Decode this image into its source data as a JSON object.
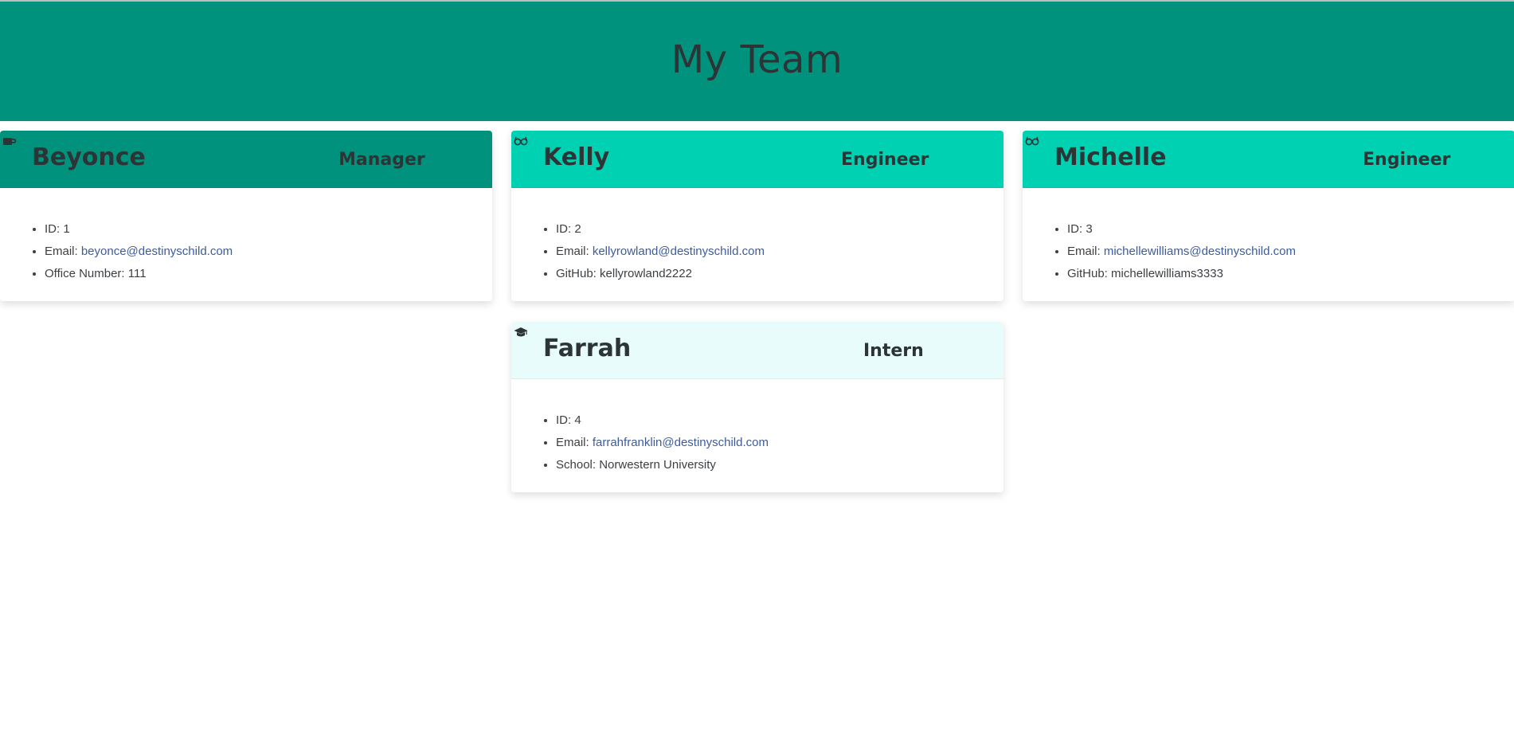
{
  "page": {
    "title": "My Team"
  },
  "colors": {
    "banner": "#00927d",
    "manager_header": "#00927d",
    "engineer_header": "#00d1b3",
    "intern_header": "#e8fdfb",
    "link": "#3d5c99",
    "text": "#2d3436"
  },
  "cards": [
    {
      "name": "Beyonce",
      "role": "Manager",
      "icon": "coffee-mug-icon",
      "id_label": "ID: 1",
      "email_label": "Email: ",
      "email": "beyonce@destinyschild.com",
      "extra_label": "Office Number: 111"
    },
    {
      "name": "Kelly",
      "role": "Engineer",
      "icon": "glasses-icon",
      "id_label": "ID: 2",
      "email_label": "Email: ",
      "email": "kellyrowland@destinyschild.com",
      "extra_label": "GitHub: kellyrowland2222"
    },
    {
      "name": "Michelle",
      "role": "Engineer",
      "icon": "glasses-icon",
      "id_label": "ID: 3",
      "email_label": "Email: ",
      "email": "michellewilliams@destinyschild.com",
      "extra_label": "GitHub: michellewilliams3333"
    },
    {
      "name": "Farrah",
      "role": "Intern",
      "icon": "graduation-cap-icon",
      "id_label": "ID: 4",
      "email_label": "Email: ",
      "email": "farrahfranklin@destinyschild.com",
      "extra_label": "School: Norwestern University"
    }
  ]
}
